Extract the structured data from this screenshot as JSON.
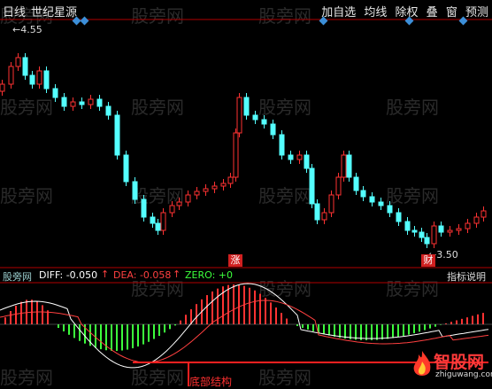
{
  "topbar": {
    "period": "日线",
    "stock_name": "世纪星源",
    "menu": [
      "加自选",
      "均线",
      "除权",
      "叠",
      "窗",
      "预测"
    ]
  },
  "watermark": "股旁网",
  "price_chart": {
    "high_label": "4.55",
    "low_label": "3.50",
    "badge_zhang": "涨",
    "badge_cai": "财"
  },
  "indicator": {
    "name": "股旁网",
    "diff_label": "DIFF: -0.050",
    "dea_label": "DEA: -0.058",
    "zero_label": "ZERO: +0",
    "explain_button": "指标说明",
    "bottom_text": "底部结构"
  },
  "logo": {
    "text": "智股网",
    "url": "zhiguwang.com"
  },
  "colors": {
    "up": "#ff3232",
    "down": "#54ffff",
    "diff": "#ffffff",
    "dea": "#ff4040",
    "axis": "#b00000"
  }
}
